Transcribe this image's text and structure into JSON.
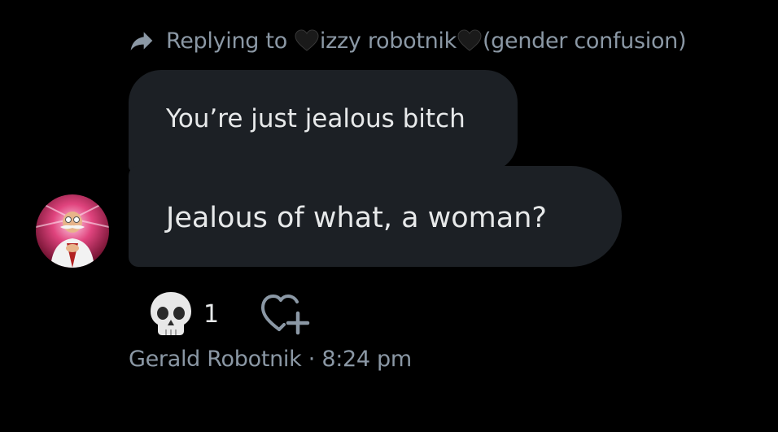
{
  "reply": {
    "prefix": "Replying to",
    "name": "izzy robotnik",
    "suffix": "(gender confusion)"
  },
  "messages": [
    {
      "text": "You’re just jealous bitch"
    },
    {
      "text": "Jealous of what, a woman?"
    }
  ],
  "reactions": {
    "emoji": "skull-icon",
    "count": "1",
    "add_icon": "add-reaction-icon"
  },
  "meta": {
    "sender": "Gerald Robotnik",
    "separator": " · ",
    "time": "8:24 pm"
  },
  "colors": {
    "background": "#000000",
    "bubble": "#1c2025",
    "text": "#e7e9ea",
    "muted": "#8b98a5",
    "heart": "#1a1a1a"
  }
}
